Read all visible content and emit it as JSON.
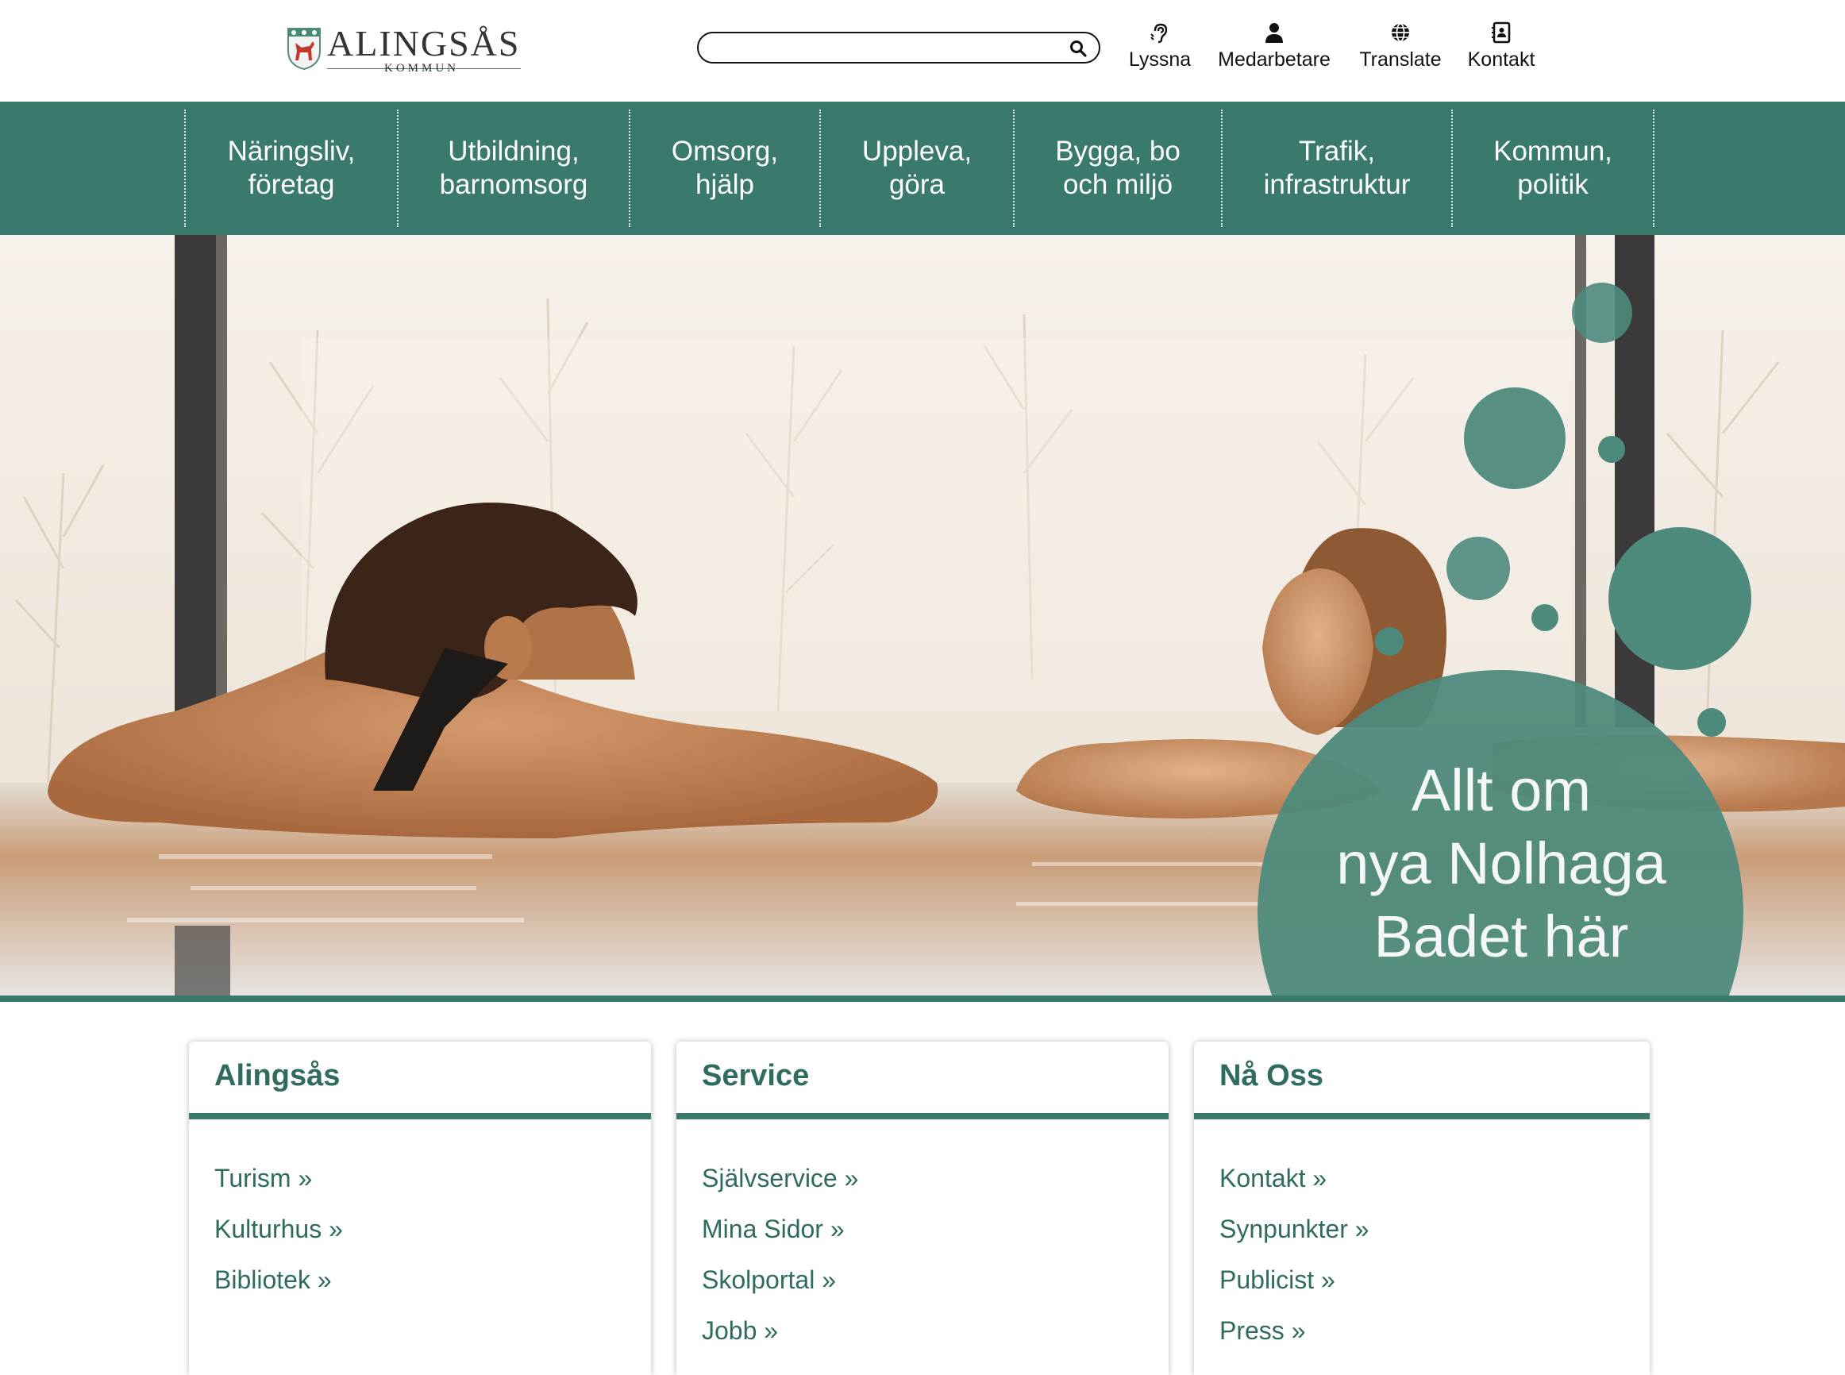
{
  "header": {
    "logo": {
      "name": "ALINGSÅS",
      "subtitle": "KOMMUN"
    },
    "search": {
      "value": "",
      "placeholder": ""
    },
    "utilities": [
      {
        "label": "Lyssna",
        "icon": "ear-icon"
      },
      {
        "label": "Medarbetare",
        "icon": "person-icon"
      },
      {
        "label": "Translate",
        "icon": "globe-icon"
      },
      {
        "label": "Kontakt",
        "icon": "contact-card-icon"
      }
    ]
  },
  "nav": {
    "items": [
      {
        "line1": "Näringsliv,",
        "line2": "företag"
      },
      {
        "line1": "Utbildning,",
        "line2": "barnomsorg"
      },
      {
        "line1": "Omsorg,",
        "line2": "hjälp"
      },
      {
        "line1": "Uppleva,",
        "line2": "göra"
      },
      {
        "line1": "Bygga, bo",
        "line2": "och miljö"
      },
      {
        "line1": "Trafik,",
        "line2": "infrastruktur"
      },
      {
        "line1": "Kommun,",
        "line2": "politik"
      }
    ]
  },
  "hero": {
    "line1": "Allt om",
    "line2": "nya Nolhaga",
    "line3": "Badet här"
  },
  "cards": [
    {
      "title": "Alingsås",
      "links": [
        "Turism »",
        "Kulturhus »",
        "Bibliotek »"
      ]
    },
    {
      "title": "Service",
      "links": [
        "Självservice »",
        "Mina Sidor »",
        "Skolportal »",
        "Jobb »"
      ]
    },
    {
      "title": "Nå Oss",
      "links": [
        "Kontakt »",
        "Synpunkter »",
        "Publicist »",
        "Press »"
      ]
    }
  ],
  "colors": {
    "brand_green": "#3a7a6c",
    "link_green": "#2f6b5f",
    "bubble_green": "#4e8a7c"
  }
}
